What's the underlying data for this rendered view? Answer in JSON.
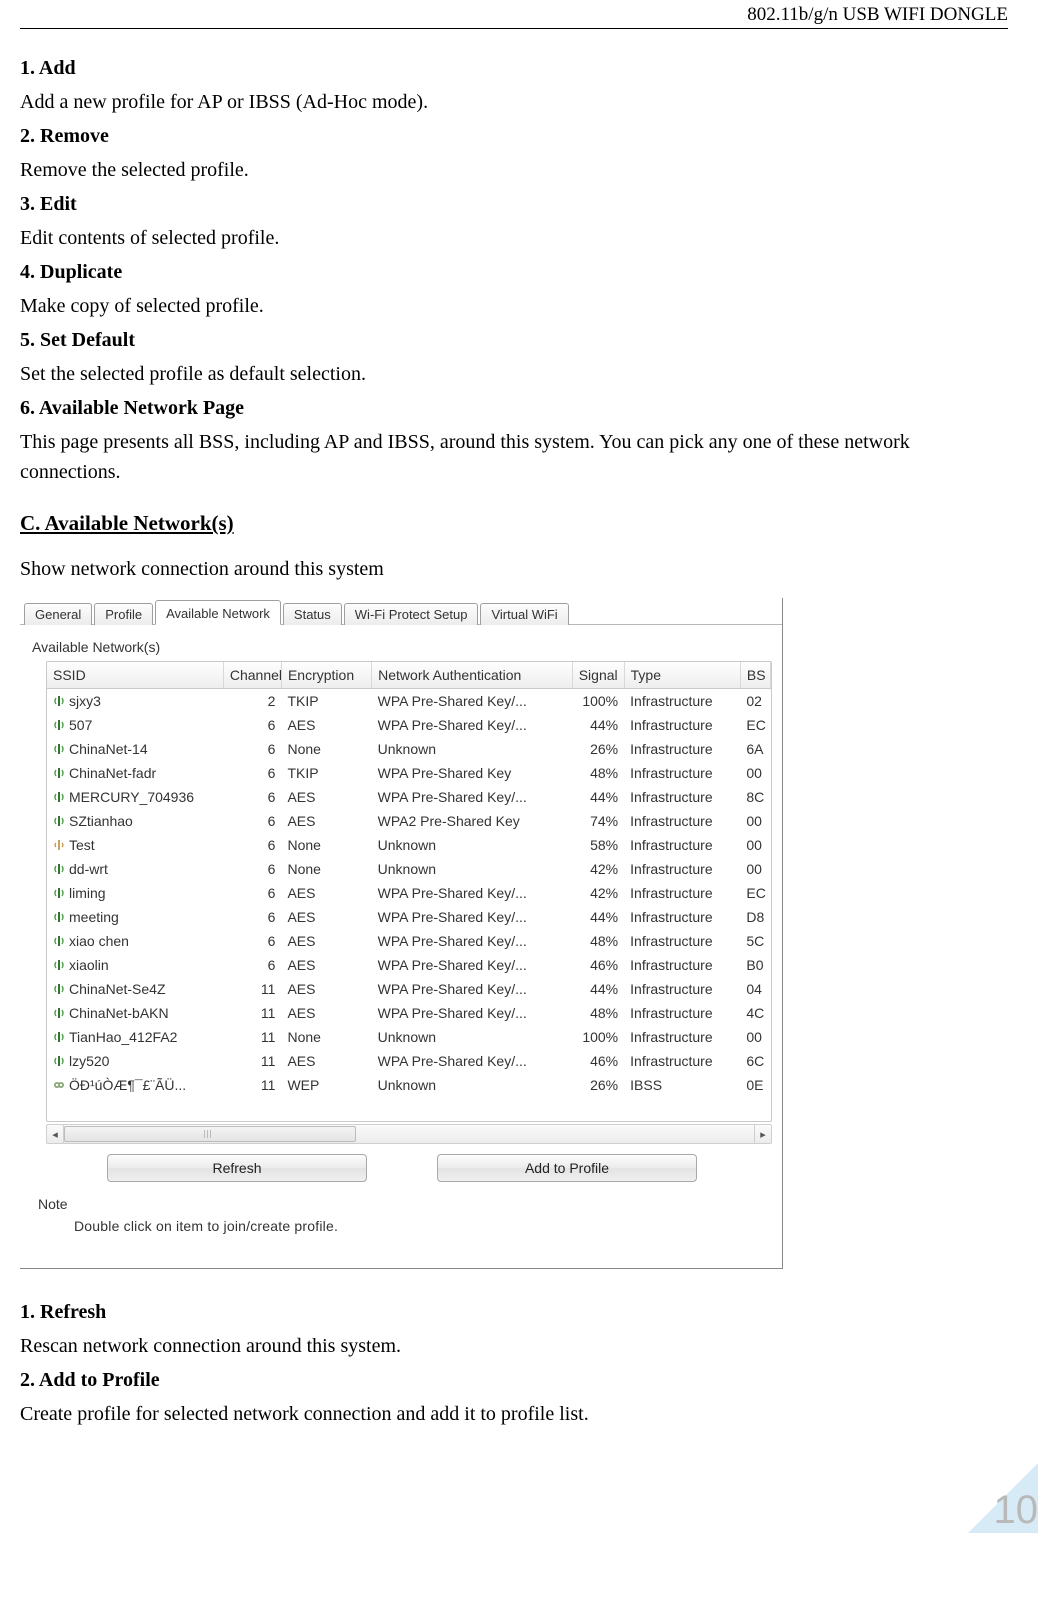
{
  "header": {
    "right_text": "802.11b/g/n USB WIFI DONGLE"
  },
  "definitions_top": [
    {
      "num": "1.",
      "title": "Add",
      "desc": "Add a new profile for AP or IBSS (Ad-Hoc mode)."
    },
    {
      "num": "2.",
      "title": "Remove",
      "desc": "Remove the selected profile."
    },
    {
      "num": "3.",
      "title": "Edit",
      "desc": "Edit contents of selected profile."
    },
    {
      "num": "4.",
      "title": "Duplicate",
      "desc": "Make copy of selected profile."
    },
    {
      "num": "5.",
      "title": "Set Default",
      "desc": "Set the selected profile as default selection."
    },
    {
      "num": "6.",
      "title": "Available Network Page",
      "desc": "This page presents all BSS, including AP and IBSS, around this system. You can pick any one of these network connections."
    }
  ],
  "section_c": {
    "heading": "C. Available Network(s)",
    "intro": "Show network connection around this system"
  },
  "screenshot": {
    "tabs": [
      "General",
      "Profile",
      "Available Network",
      "Status",
      "Wi-Fi Protect Setup",
      "Virtual WiFi"
    ],
    "active_tab_index": 2,
    "panel_title": "Available Network(s)",
    "columns": [
      "SSID",
      "Channel",
      "Encryption",
      "Network Authentication",
      "Signal",
      "Type",
      "BS"
    ],
    "rows": [
      {
        "icon": "ap",
        "ssid": "sjxy3",
        "channel": "2",
        "enc": "TKIP",
        "auth": "WPA Pre-Shared Key/...",
        "signal": "100%",
        "type": "Infrastructure",
        "bs": "02"
      },
      {
        "icon": "ap",
        "ssid": "507",
        "channel": "6",
        "enc": "AES",
        "auth": "WPA Pre-Shared Key/...",
        "signal": "44%",
        "type": "Infrastructure",
        "bs": "EC"
      },
      {
        "icon": "ap",
        "ssid": "ChinaNet-14",
        "channel": "6",
        "enc": "None",
        "auth": "Unknown",
        "signal": "26%",
        "type": "Infrastructure",
        "bs": "6A"
      },
      {
        "icon": "ap",
        "ssid": "ChinaNet-fadr",
        "channel": "6",
        "enc": "TKIP",
        "auth": "WPA Pre-Shared Key",
        "signal": "48%",
        "type": "Infrastructure",
        "bs": "00"
      },
      {
        "icon": "ap",
        "ssid": "MERCURY_704936",
        "channel": "6",
        "enc": "AES",
        "auth": "WPA Pre-Shared Key/...",
        "signal": "44%",
        "type": "Infrastructure",
        "bs": "8C"
      },
      {
        "icon": "ap",
        "ssid": "SZtianhao",
        "channel": "6",
        "enc": "AES",
        "auth": "WPA2 Pre-Shared Key",
        "signal": "74%",
        "type": "Infrastructure",
        "bs": "00"
      },
      {
        "icon": "open",
        "ssid": "Test",
        "channel": "6",
        "enc": "None",
        "auth": "Unknown",
        "signal": "58%",
        "type": "Infrastructure",
        "bs": "00"
      },
      {
        "icon": "ap",
        "ssid": "dd-wrt",
        "channel": "6",
        "enc": "None",
        "auth": "Unknown",
        "signal": "42%",
        "type": "Infrastructure",
        "bs": "00"
      },
      {
        "icon": "ap",
        "ssid": "liming",
        "channel": "6",
        "enc": "AES",
        "auth": "WPA Pre-Shared Key/...",
        "signal": "42%",
        "type": "Infrastructure",
        "bs": "EC"
      },
      {
        "icon": "ap",
        "ssid": "meeting",
        "channel": "6",
        "enc": "AES",
        "auth": "WPA Pre-Shared Key/...",
        "signal": "44%",
        "type": "Infrastructure",
        "bs": "D8"
      },
      {
        "icon": "ap",
        "ssid": "xiao chen",
        "channel": "6",
        "enc": "AES",
        "auth": "WPA Pre-Shared Key/...",
        "signal": "48%",
        "type": "Infrastructure",
        "bs": "5C"
      },
      {
        "icon": "ap",
        "ssid": "xiaolin",
        "channel": "6",
        "enc": "AES",
        "auth": "WPA Pre-Shared Key/...",
        "signal": "46%",
        "type": "Infrastructure",
        "bs": "B0"
      },
      {
        "icon": "ap",
        "ssid": "ChinaNet-Se4Z",
        "channel": "11",
        "enc": "AES",
        "auth": "WPA Pre-Shared Key/...",
        "signal": "44%",
        "type": "Infrastructure",
        "bs": "04"
      },
      {
        "icon": "ap",
        "ssid": "ChinaNet-bAKN",
        "channel": "11",
        "enc": "AES",
        "auth": "WPA Pre-Shared Key/...",
        "signal": "48%",
        "type": "Infrastructure",
        "bs": "4C"
      },
      {
        "icon": "ap",
        "ssid": "TianHao_412FA2",
        "channel": "11",
        "enc": "None",
        "auth": "Unknown",
        "signal": "100%",
        "type": "Infrastructure",
        "bs": "00"
      },
      {
        "icon": "ap",
        "ssid": "lzy520",
        "channel": "11",
        "enc": "AES",
        "auth": "WPA Pre-Shared Key/...",
        "signal": "46%",
        "type": "Infrastructure",
        "bs": "6C"
      },
      {
        "icon": "ibss",
        "ssid": "ÖÐ¹úÒÆ¶¯£¨ÃÜ...",
        "channel": "11",
        "enc": "WEP",
        "auth": "Unknown",
        "signal": "26%",
        "type": "IBSS",
        "bs": "0E"
      }
    ],
    "buttons": {
      "refresh": "Refresh",
      "add_to_profile": "Add to Profile"
    },
    "note": {
      "label": "Note",
      "text": "Double click on item to join/create profile."
    }
  },
  "definitions_bottom": [
    {
      "num": "1.",
      "title": "Refresh",
      "desc": "Rescan network connection around this system."
    },
    {
      "num": "2.",
      "title": "Add to Profile",
      "desc": "Create profile for selected network connection and add it to profile list."
    }
  ],
  "page_number": "10"
}
